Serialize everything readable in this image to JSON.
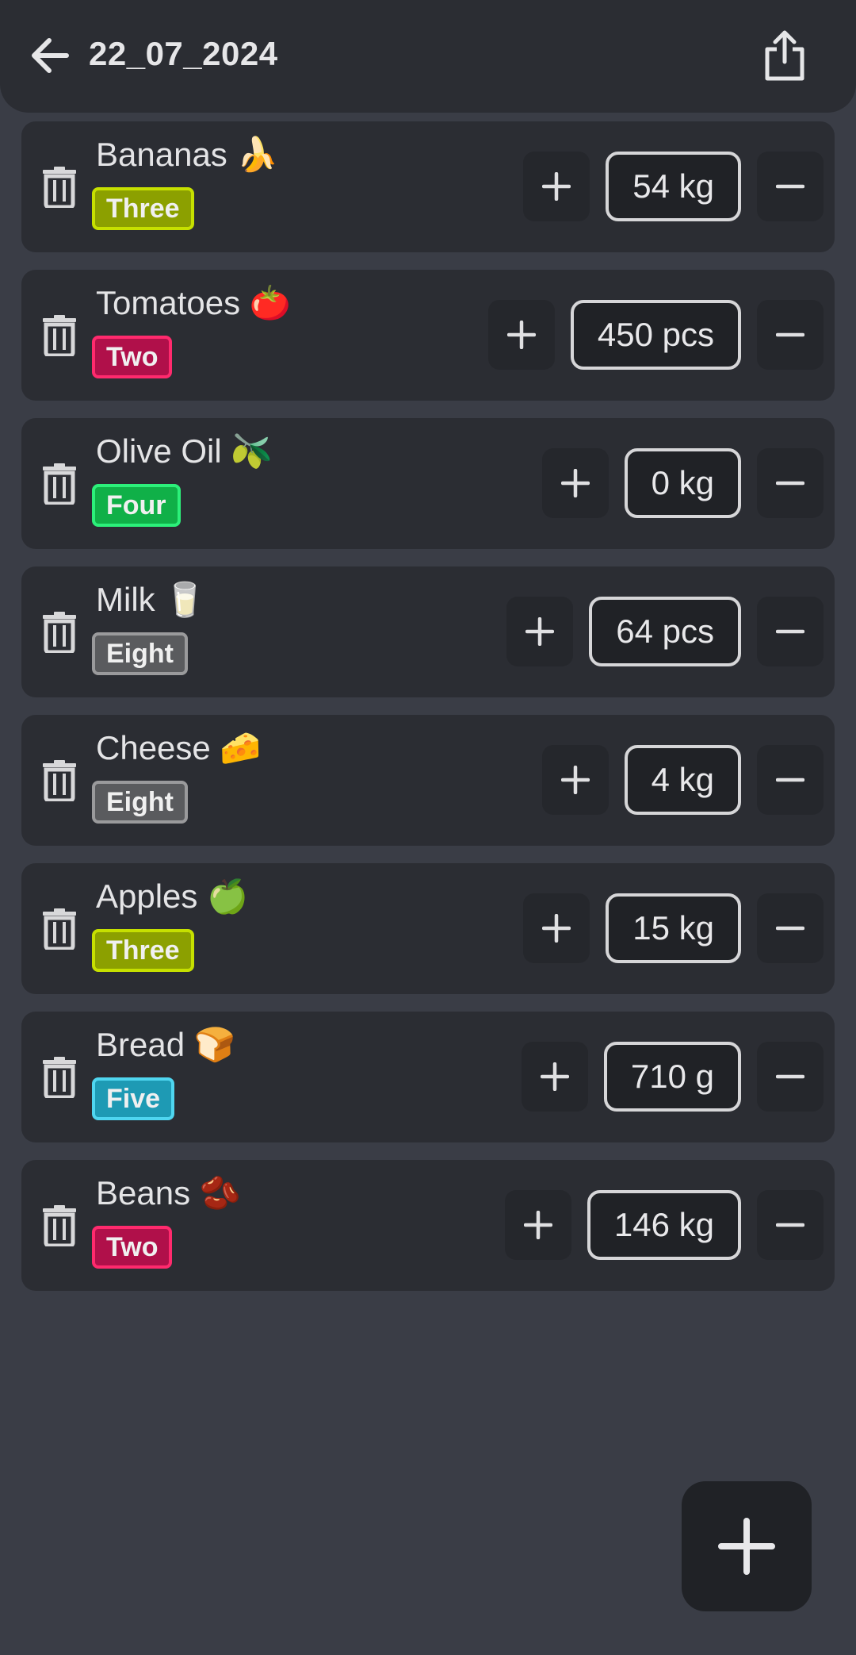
{
  "header": {
    "title": "22_07_2024",
    "back_icon": "arrow-left-icon",
    "share_icon": "share-icon"
  },
  "items": [
    {
      "name": "Bananas 🍌",
      "tag": "Three",
      "tag_color": "#c6e000",
      "tag_bg": "#8ca000",
      "quantity": "54 kg"
    },
    {
      "name": "Tomatoes 🍅",
      "tag": "Two",
      "tag_color": "#ff2a6d",
      "tag_bg": "#b0104a",
      "quantity": "450 pcs"
    },
    {
      "name": "Olive Oil 🫒",
      "tag": "Four",
      "tag_color": "#2cf07a",
      "tag_bg": "#10b048",
      "quantity": "0 kg"
    },
    {
      "name": "Milk 🥛",
      "tag": "Eight",
      "tag_color": "#9a9a9c",
      "tag_bg": "#5a5b5e",
      "quantity": "64 pcs"
    },
    {
      "name": "Cheese 🧀",
      "tag": "Eight",
      "tag_color": "#9a9a9c",
      "tag_bg": "#5a5b5e",
      "quantity": "4 kg"
    },
    {
      "name": "Apples 🍏",
      "tag": "Three",
      "tag_color": "#c6e000",
      "tag_bg": "#8ca000",
      "quantity": "15 kg"
    },
    {
      "name": "Bread 🍞",
      "tag": "Five",
      "tag_color": "#4fd6f0",
      "tag_bg": "#1e9ab4",
      "quantity": "710 g"
    },
    {
      "name": "Beans 🫘",
      "tag": "Two",
      "tag_color": "#ff2a6d",
      "tag_bg": "#b0104a",
      "quantity": "146 kg"
    }
  ],
  "fab": {
    "icon": "plus-icon"
  }
}
